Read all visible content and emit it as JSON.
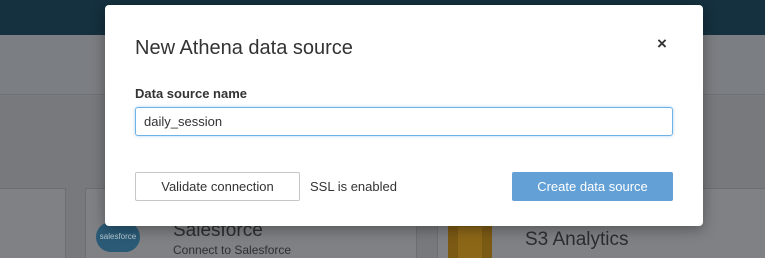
{
  "background": {
    "cards": [
      {
        "title": "Salesforce",
        "subtitle": "Connect to Salesforce",
        "logo_text": "salesforce"
      },
      {
        "title": "S3 Analytics"
      }
    ]
  },
  "modal": {
    "title": "New Athena data source",
    "close_symbol": "×",
    "field_label": "Data source name",
    "name_value": "daily_session",
    "validate_label": "Validate connection",
    "ssl_status": "SSL is enabled",
    "create_label": "Create data source"
  },
  "colors": {
    "topbar": "#15303f",
    "primary_button": "#62a0d6",
    "input_focus_border": "#6fb3e6"
  }
}
